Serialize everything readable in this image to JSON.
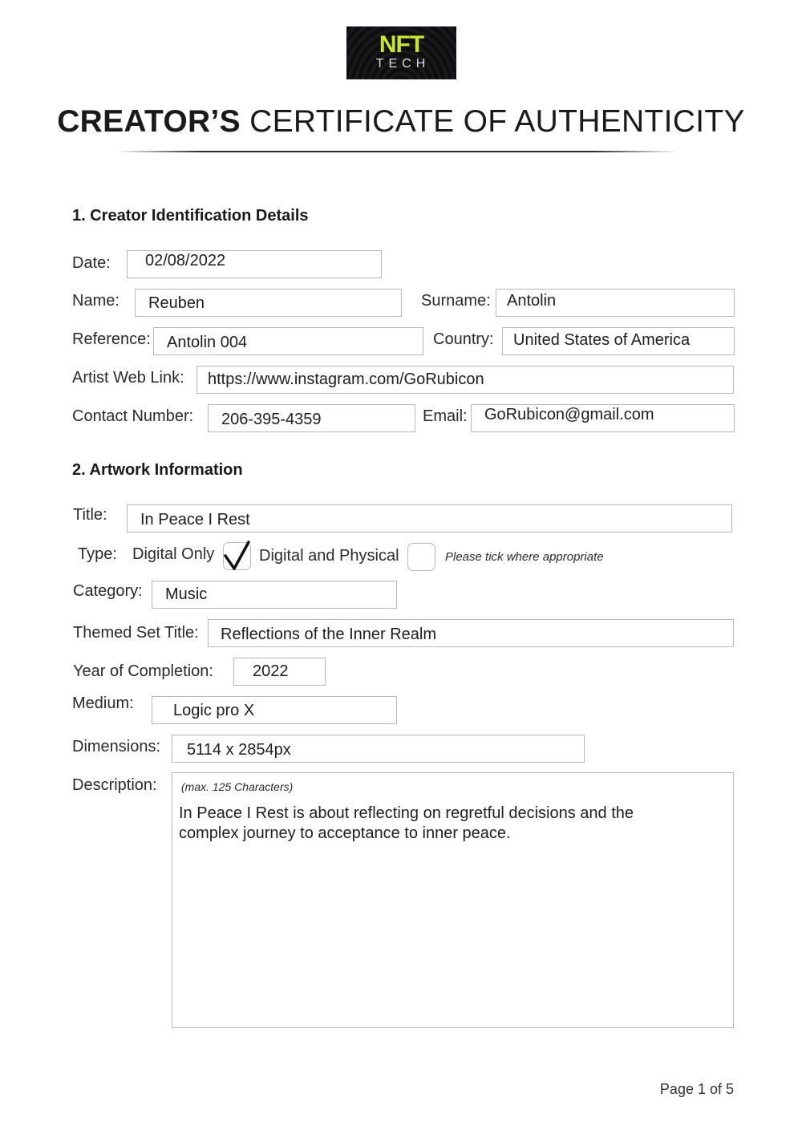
{
  "logo": {
    "line1": "NFT",
    "line2": "TECH",
    "accent_color": "#c8e23a"
  },
  "header": {
    "title_bold": "CREATOR’S",
    "title_rest": " CERTIFICATE OF AUTHENTICITY"
  },
  "section1": {
    "heading": "1. Creator Identification Details",
    "date": {
      "label": "Date:",
      "value": "02/08/2022"
    },
    "name": {
      "label": "Name:",
      "value": "Reuben"
    },
    "surname": {
      "label": "Surname:",
      "value": "Antolin"
    },
    "reference": {
      "label": "Reference:",
      "value": "Antolin 004"
    },
    "country": {
      "label": "Country:",
      "value": "United States of America"
    },
    "web_link": {
      "label": "Artist Web Link:",
      "value": "https://www.instagram.com/GoRubicon"
    },
    "contact": {
      "label": "Contact Number:",
      "value": "206-395-4359"
    },
    "email": {
      "label": "Email:",
      "value": "GoRubicon@gmail.com"
    }
  },
  "section2": {
    "heading": "2. Artwork Information",
    "title": {
      "label": "Title:",
      "value": "In Peace I Rest"
    },
    "type": {
      "label": "Type:",
      "options": [
        {
          "label": "Digital Only",
          "checked": true
        },
        {
          "label": "Digital and Physical",
          "checked": false
        }
      ],
      "hint": "Please tick where appropriate"
    },
    "category": {
      "label": "Category:",
      "value": "Music"
    },
    "themed_set": {
      "label": "Themed Set Title:",
      "value": "Reflections of the Inner Realm"
    },
    "year": {
      "label": "Year of Completion:",
      "value": "2022"
    },
    "medium": {
      "label": "Medium:",
      "value": "Logic pro X"
    },
    "dimensions": {
      "label": "Dimensions:",
      "value": "5114 x 2854px"
    },
    "description": {
      "label": "Description:",
      "hint": "(max. 125 Characters)",
      "value": "In Peace I Rest is about reflecting on regretful decisions and the complex journey to acceptance to inner peace."
    }
  },
  "footer": {
    "page": "Page 1 of 5"
  }
}
